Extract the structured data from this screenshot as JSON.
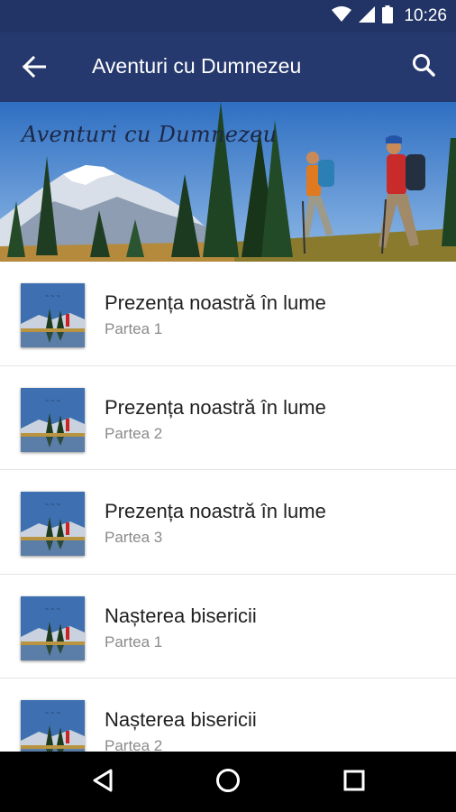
{
  "status_bar": {
    "time": "10:26",
    "icons": [
      "wifi-icon",
      "cell-signal-icon",
      "battery-icon"
    ]
  },
  "app_bar": {
    "title": "Aventuri cu Dumnezeu",
    "back_icon": "arrow-back-icon",
    "search_icon": "search-icon",
    "background_color": "#26396e"
  },
  "banner": {
    "title": "Aventuri cu Dumnezeu"
  },
  "list": {
    "items": [
      {
        "title": "Prezența noastră în lume",
        "subtitle": "Partea 1"
      },
      {
        "title": "Prezența noastră în lume",
        "subtitle": "Partea 2"
      },
      {
        "title": "Prezența noastră în lume",
        "subtitle": "Partea 3"
      },
      {
        "title": "Nașterea bisericii",
        "subtitle": "Partea 1"
      },
      {
        "title": "Nașterea bisericii",
        "subtitle": "Partea 2"
      }
    ]
  },
  "nav_bar": {
    "icons": [
      "back-triangle-icon",
      "home-circle-icon",
      "recents-square-icon"
    ]
  }
}
